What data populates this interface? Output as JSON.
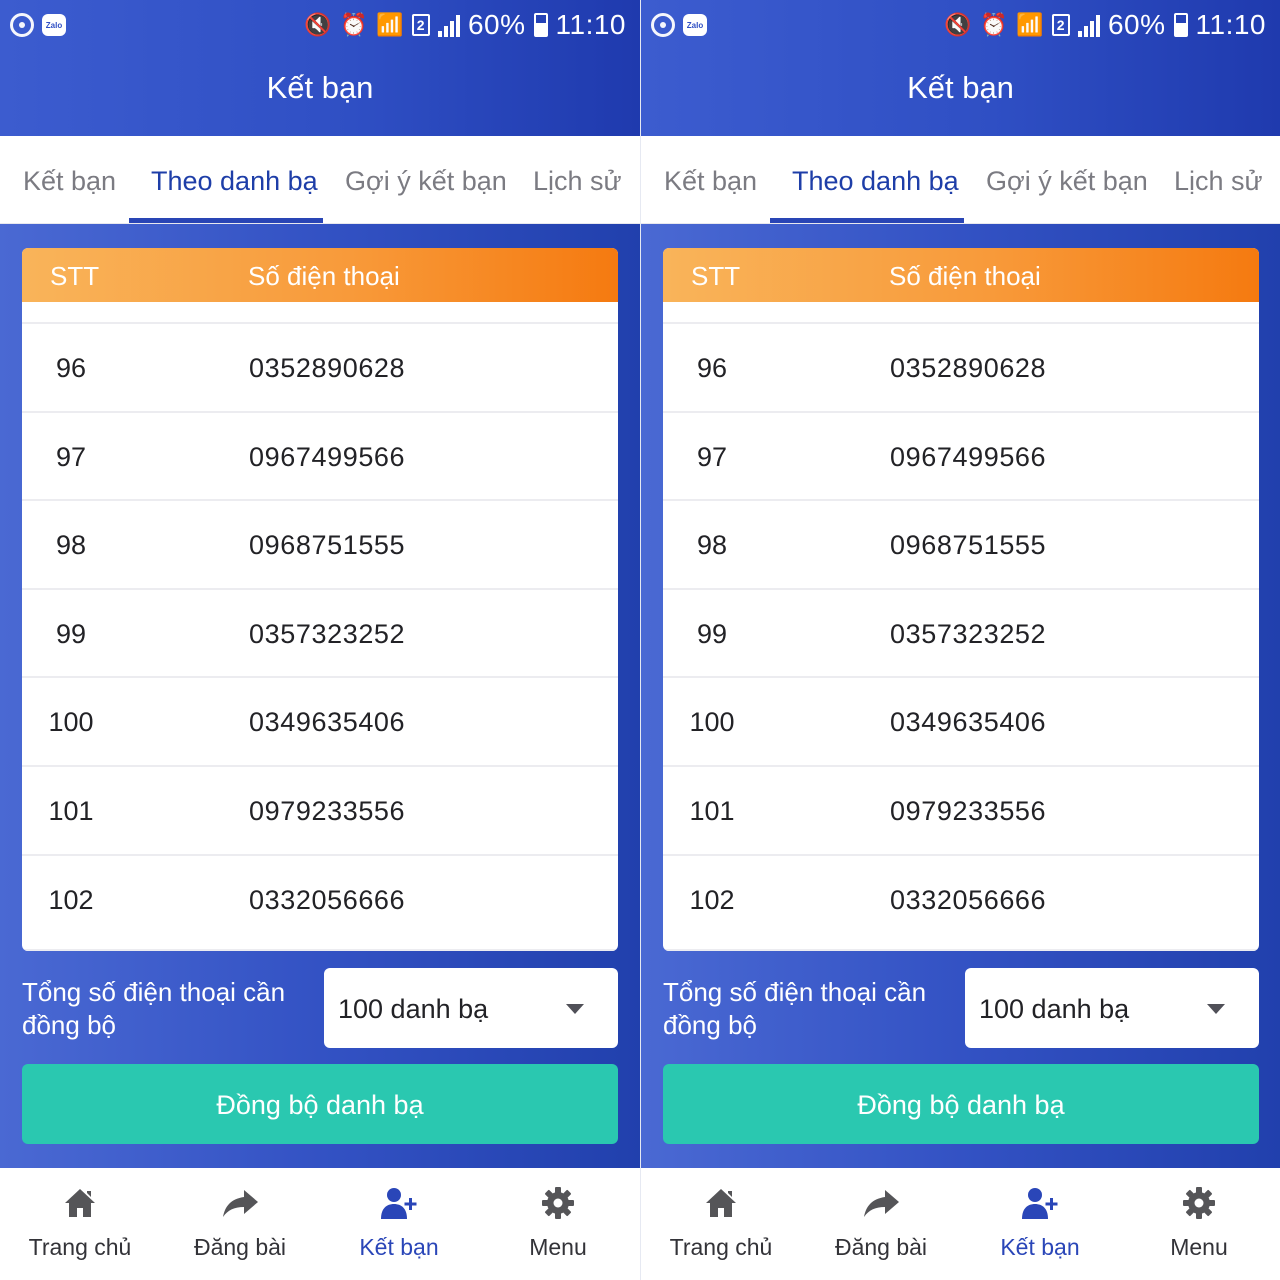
{
  "status_bar": {
    "battery": "60%",
    "time": "11:10",
    "sim": "2"
  },
  "header": {
    "title": "Kết bạn"
  },
  "tabs": [
    {
      "label": "Kết bạn",
      "active": false
    },
    {
      "label": "Theo danh bạ",
      "active": true
    },
    {
      "label": "Gợi ý kết bạn",
      "active": false
    },
    {
      "label": "Lịch sử",
      "active": false
    }
  ],
  "table": {
    "columns": [
      "STT",
      "Số điện thoại"
    ],
    "rows": [
      {
        "stt": "96",
        "phone": "0352890628"
      },
      {
        "stt": "97",
        "phone": "0967499566"
      },
      {
        "stt": "98",
        "phone": "0968751555"
      },
      {
        "stt": "99",
        "phone": "0357323252"
      },
      {
        "stt": "100",
        "phone": "0349635406"
      },
      {
        "stt": "101",
        "phone": "0979233556"
      },
      {
        "stt": "102",
        "phone": "0332056666"
      }
    ]
  },
  "sync": {
    "label": "Tổng số điện thoại cần đồng bộ",
    "selected": "100 danh bạ",
    "button": "Đồng bộ danh bạ"
  },
  "bottom_nav": [
    {
      "label": "Trang chủ",
      "icon": "home-icon",
      "active": false
    },
    {
      "label": "Đăng bài",
      "icon": "share-icon",
      "active": false
    },
    {
      "label": "Kết bạn",
      "icon": "add-friend-icon",
      "active": true
    },
    {
      "label": "Menu",
      "icon": "gear-icon",
      "active": false
    }
  ],
  "colors": {
    "header_blue": "#2f4fc4",
    "active_tab": "#1e3ea8",
    "table_header_orange": "#f89a3a",
    "sync_button": "#2ac8b0",
    "active_nav": "#2a46b8"
  }
}
